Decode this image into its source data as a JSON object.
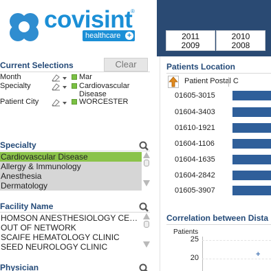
{
  "brand": {
    "name": "covisint",
    "reg": "®",
    "sub": "healthcare"
  },
  "year_buttons": [
    {
      "top": "2011",
      "bottom": "2009"
    },
    {
      "top": "2010",
      "bottom": "2008"
    }
  ],
  "current_selections": {
    "title": "Current Selections",
    "clear_label": "Clear",
    "rows": [
      {
        "label": "Month",
        "value": "Mar"
      },
      {
        "label": "Specialty",
        "value": "Cardiovascular Disease"
      },
      {
        "label": "Patient City",
        "value": "WORCESTER"
      }
    ]
  },
  "specialty": {
    "title": "Specialty",
    "items": [
      "Cardiovascular Disease",
      "Allergy & Immunology",
      "Anesthesia",
      "Dermatology"
    ]
  },
  "facility": {
    "title": "Facility Name",
    "items": [
      "HOMSON ANESTHESIOLOGY  CE…",
      "OUT OF NETWORK",
      "SCAIFE HEMATOLOGY  CLINIC",
      "SEED NEUROLOGY  CLINIC"
    ]
  },
  "physician": {
    "title": "Physician"
  },
  "patients_location": {
    "title": "Patients Location",
    "dimension_label": "Patient Postal C",
    "rows": [
      "01605-3015",
      "01604-3403",
      "01610-1921",
      "01604-1106",
      "01604-1635",
      "01604-2842",
      "01605-3907"
    ]
  },
  "correlation": {
    "title": "Correlation between Dista",
    "axis_title": "Patients",
    "ticks": [
      "25",
      "20"
    ],
    "point_symbol": "+"
  },
  "colors": {
    "brand_blue": "#1b8fd6",
    "header_navy": "#2a4a73",
    "section_title": "#244a78",
    "selected_green": "#8bc34a",
    "bar_blue": "#2f5f9a"
  }
}
